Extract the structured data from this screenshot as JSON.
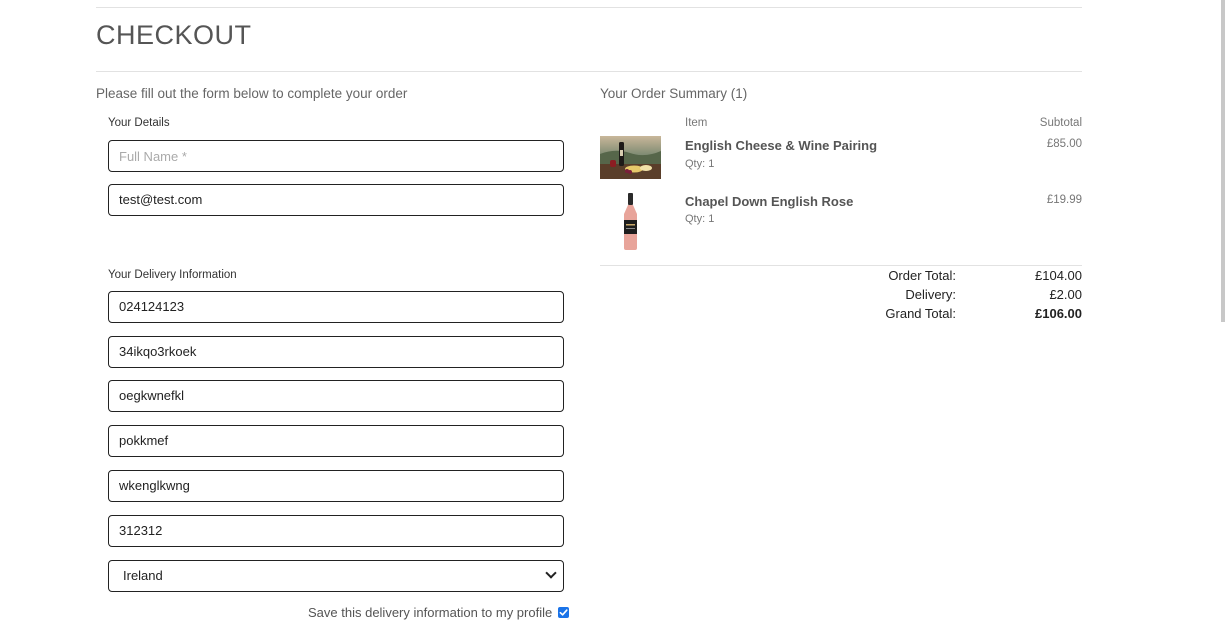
{
  "page": {
    "title": "CHECKOUT"
  },
  "form": {
    "intro": "Please fill out the form below to complete your order",
    "details_legend": "Your Details",
    "full_name": {
      "value": "",
      "placeholder": "Full Name *"
    },
    "email": {
      "value": "test@test.com"
    },
    "delivery_legend": "Your Delivery Information",
    "phone": {
      "value": "024124123"
    },
    "street1": {
      "value": "34ikqo3rkoek"
    },
    "street2": {
      "value": "oegkwnefkl"
    },
    "town": {
      "value": "pokkmef"
    },
    "county": {
      "value": "wkenglkwng"
    },
    "postcode": {
      "value": "312312"
    },
    "country": {
      "selected": "Ireland"
    },
    "save_info_label": "Save this delivery information to my profile",
    "save_info_checked": true
  },
  "summary": {
    "title": "Your Order Summary (1)",
    "col_item": "Item",
    "col_subtotal": "Subtotal",
    "items": [
      {
        "name": "English Cheese & Wine Pairing",
        "qty": "Qty: 1",
        "subtotal": "£85.00",
        "image": "cheese-wine-photo"
      },
      {
        "name": "Chapel Down English Rose",
        "qty": "Qty: 1",
        "subtotal": "£19.99",
        "image": "rose-bottle-photo"
      }
    ],
    "order_total_label": "Order Total:",
    "order_total": "£104.00",
    "delivery_label": "Delivery:",
    "delivery": "£2.00",
    "grand_total_label": "Grand Total:",
    "grand_total": "£106.00"
  },
  "colors": {
    "checkbox": "#1a73e8",
    "border": "#222222",
    "muted_text": "#666666"
  }
}
